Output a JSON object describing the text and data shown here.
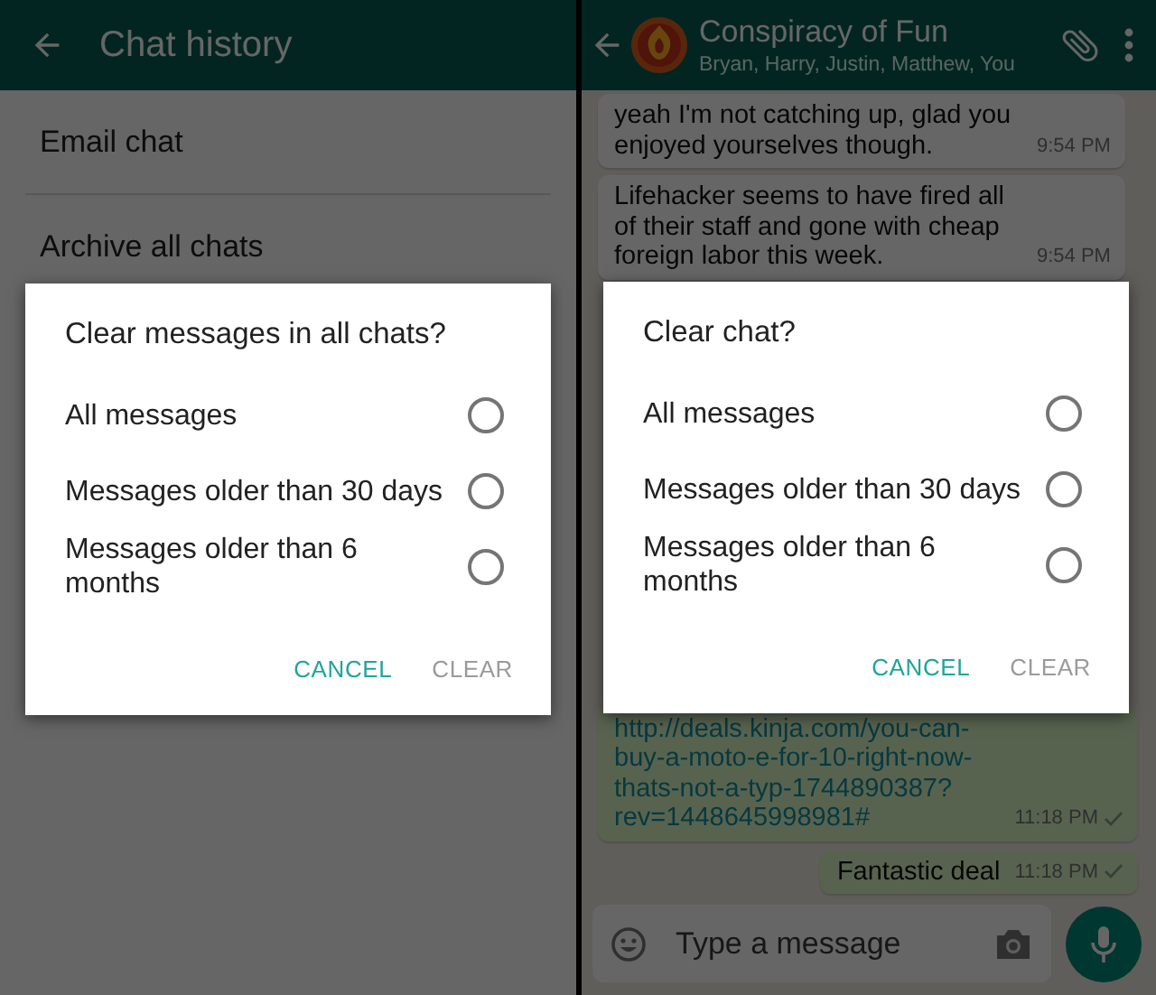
{
  "screens": [
    {
      "kind": "settings",
      "app_bar": {
        "title": "Chat history"
      },
      "items": [
        {
          "label": "Email chat"
        },
        {
          "label": "Archive all chats"
        }
      ],
      "dialog": {
        "title": "Clear messages in all chats?",
        "options": [
          {
            "label": "All messages",
            "selected": false
          },
          {
            "label": "Messages older than 30 days",
            "selected": false
          },
          {
            "label": "Messages older than 6 months",
            "selected": false
          }
        ],
        "buttons": [
          {
            "label": "CANCEL",
            "disabled": false
          },
          {
            "label": "CLEAR",
            "disabled": true
          }
        ]
      }
    },
    {
      "kind": "chat",
      "app_bar": {
        "title": "Conspiracy of Fun",
        "subtitle": "Bryan, Harry, Justin, Matthew, You"
      },
      "earlier_messages": [
        {
          "outgoing": false,
          "kind": "text",
          "text": "yeah I'm not catching up, glad you enjoyed yourselves though.",
          "time": "9:54 PM"
        },
        {
          "outgoing": false,
          "kind": "text",
          "text": "Lifehacker seems to have fired all of their staff and gone with cheap foreign labor this week.",
          "time": "9:54 PM"
        }
      ],
      "later_messages": [
        {
          "outgoing": true,
          "kind": "link",
          "text": "http://deals.kinja.com/you-can-buy-a-moto-e-for-10-right-now-thats-not-a-typ-1744890387?rev=1448645998981#",
          "time": "11:18 PM",
          "sent": true
        },
        {
          "outgoing": true,
          "kind": "text",
          "text": "Fantastic deal",
          "time": "11:18 PM",
          "sent": true
        }
      ],
      "composer": {
        "placeholder": "Type a message"
      },
      "dialog": {
        "title": "Clear chat?",
        "options": [
          {
            "label": "All messages",
            "selected": false
          },
          {
            "label": "Messages older than 30 days",
            "selected": false
          },
          {
            "label": "Messages older than 6 months",
            "selected": false
          }
        ],
        "buttons": [
          {
            "label": "CANCEL",
            "disabled": false
          },
          {
            "label": "CLEAR",
            "disabled": true
          }
        ]
      }
    }
  ]
}
